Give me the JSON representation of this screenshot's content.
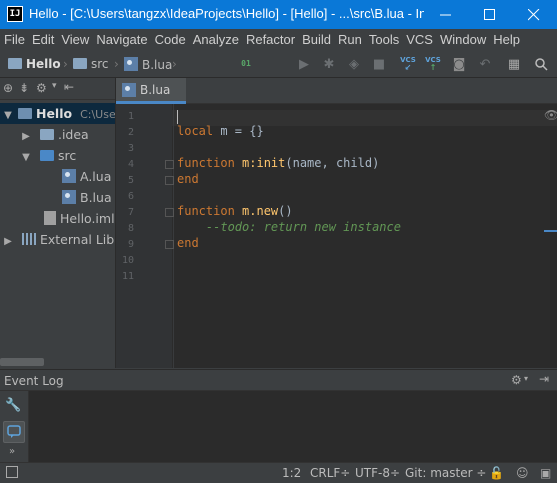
{
  "titlebar": {
    "app_icon": "intellij-idea-icon",
    "app_icon_text": "IJ",
    "title": "Hello - [C:\\Users\\tangzx\\IdeaProjects\\Hello] - [Hello] - ...\\src\\B.lua - IntelliJ IDEA",
    "minimize": "—",
    "maximize": "☐",
    "close": "✕"
  },
  "menu": [
    "File",
    "Edit",
    "View",
    "Navigate",
    "Code",
    "Analyze",
    "Refactor",
    "Build",
    "Run",
    "Tools",
    "VCS",
    "Window",
    "Help"
  ],
  "breadcrumb": {
    "project": "Hello",
    "folder": "src",
    "file": "B.lua"
  },
  "toolbar": {
    "vcs_label": "VCS",
    "binary_label": "01"
  },
  "project_tree": [
    {
      "label": "Hello",
      "path": "C:\\Users\\tangzx\\IdeaProjects\\Hello",
      "type": "project-folder",
      "arrow": "▼",
      "selected": true
    },
    {
      "label": ".idea",
      "type": "folder",
      "arrow": "▶"
    },
    {
      "label": "src",
      "type": "folder",
      "arrow": "▼"
    },
    {
      "label": "A.lua",
      "type": "lua-file"
    },
    {
      "label": "B.lua",
      "type": "lua-file"
    },
    {
      "label": "Hello.iml",
      "type": "iml-file"
    },
    {
      "label": "External Libraries",
      "type": "libraries",
      "arrow": "▶"
    }
  ],
  "editor": {
    "tab_label": "B.lua",
    "line_numbers": [
      "1",
      "2",
      "3",
      "4",
      "5",
      "6",
      "7",
      "8",
      "9",
      "10",
      "11"
    ],
    "lines": {
      "l1": "",
      "l2_kw": "local",
      "l2_rest": " m = {}",
      "l4_kw": "function",
      "l4_name": " m:init",
      "l4_rest": "(name, child)",
      "l5_kw": "end",
      "l7_kw": "function",
      "l7_name": " m.new",
      "l7_rest": "()",
      "l8_comment": "    --todo: return new instance",
      "l9_kw": "end"
    }
  },
  "event_log": {
    "title": "Event Log"
  },
  "status": {
    "position": "1:2",
    "line_sep": "CRLF÷",
    "encoding": "UTF-8÷",
    "git": "Git: master ÷"
  },
  "colors": {
    "titlebar": "#0a78d7",
    "editor_bg": "#2b2b2b",
    "keyword": "#cc7832",
    "function": "#ffc66d",
    "comment": "#629755"
  }
}
